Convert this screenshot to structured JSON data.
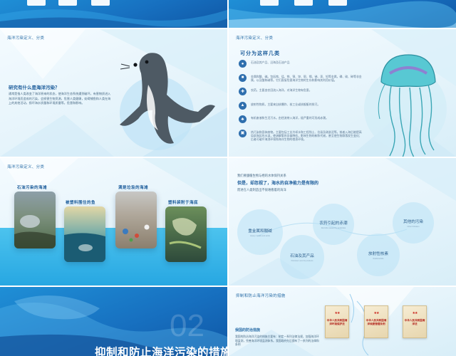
{
  "colors": {
    "primary_blue": "#1d5d9b",
    "light_bg": "#e6f4fb",
    "dark_bg": "#1770c0",
    "accent_cyan": "#27a7e2",
    "seal_gray": "#4e5a64",
    "jelly_teal": "#3bb6c4",
    "book_red": "#c8231b"
  },
  "slides": {
    "c": {
      "section": "海洋污染定义、分类",
      "question": "研究有什么是海洋污染？",
      "body": "通常是指人类改变了海洋原来的状态，使海洋生态系统遭到破坏。有害物质进入海洋环境而造成的污染，会损害生物资源，危害人类健康，妨碍捕鱼和人类在海上的其他活动，损坏海水质量和环境质量等。危害和影响。"
    },
    "d": {
      "section": "海洋污染定义、分类",
      "heading": "可分为这样几类",
      "items": [
        {
          "icon": "oil-drop-icon",
          "text": "石油及其产品、沿海及石油产品"
        },
        {
          "icon": "metal-icon",
          "text": "金属和酸、碱。包括铬、锰、铁、铜、锌、银、镉、锑、汞、铅等金属，磷、硫、砷等非金属，以及酸和碱等。它们直接危害海洋生物的生存和影响其利用价值。"
        },
        {
          "icon": "pesticide-icon",
          "text": "农药。主要由农田流入海洋，对海洋生物有危害。"
        },
        {
          "icon": "radiation-icon",
          "text": "放射性物质。主要来自核爆炸、核工业或核舰艇的排污。"
        },
        {
          "icon": "leaf-icon",
          "text": "有机废液和生活污水。由径流带入海洋，极严重的可形成赤潮。"
        },
        {
          "icon": "factory-icon",
          "text": "热污染和固体废物。主要包括工业冷却水和工程残土、垃圾及疏浚泥等。前者入海后能提高局部海区的水温，使溶解氧的含量降低，影响生物的新陈代谢，甚至使生物群落发生变化；后者可破坏海滨环境和海洋生物的栖息环境。"
        }
      ]
    },
    "e": {
      "section": "海洋污染定义、分类",
      "labels": [
        "石油污染的海滩",
        "被塑料围住的鱼",
        "满是垃圾的海滩",
        "塑料袋附于海底"
      ]
    },
    "f": {
      "line1": "我们要遵循生物与栖的水体保持关系",
      "line2": "但是，却忽视了，海水的自净能力是有限的",
      "line3": "而进在人类制造出不很难看着的海洋",
      "circles": [
        {
          "title": "重金属和酸碱",
          "sub": "Heavy metals and acids"
        },
        {
          "title": "农药引起的赤潮",
          "sub": "Red tide caused by pesticides"
        },
        {
          "title": "其他的污染",
          "sub": "Other Pollution"
        },
        {
          "title": "石油及其产品",
          "sub": "Petroleum and its products"
        },
        {
          "title": "放射性核素",
          "sub": "Radionuclide"
        }
      ]
    },
    "g": {
      "number": "02",
      "title": "抑制和防止海洋污染的措施"
    },
    "h": {
      "section": "抑制和防止海洋污染的措施",
      "sub": "我国的防治措施",
      "body": "我国的防治海洋污染的措施主要有：制定一系列法律法规，加强海洋环境监测，完善海洋环境监测体系。我国政府先后颁布了一系列的法律和条例",
      "books": [
        "中华人民共和国海洋环境保护法",
        "中华人民共和国海洋倾废管理条例",
        "中华人民共和国海洋法"
      ]
    }
  }
}
